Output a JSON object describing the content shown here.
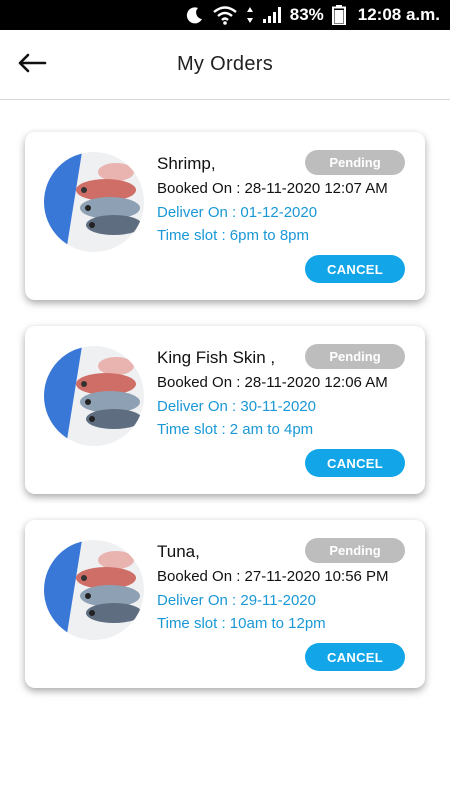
{
  "status_bar": {
    "battery": "83%",
    "time": "12:08 a.m."
  },
  "header": {
    "title": "My Orders"
  },
  "orders": [
    {
      "name": "Shrimp,",
      "status": "Pending",
      "booked_on": "Booked On : 28-11-2020 12:07 AM",
      "deliver_on": "Deliver On  : 01-12-2020",
      "time_slot": "Time slot : 6pm to 8pm",
      "cancel_label": "CANCEL"
    },
    {
      "name": "King Fish Skin ,",
      "status": "Pending",
      "booked_on": "Booked On : 28-11-2020 12:06 AM",
      "deliver_on": "Deliver On  : 30-11-2020",
      "time_slot": "Time slot : 2 am to 4pm",
      "cancel_label": "CANCEL"
    },
    {
      "name": "Tuna,",
      "status": "Pending",
      "booked_on": "Booked On : 27-11-2020 10:56 PM",
      "deliver_on": "Deliver On  : 29-11-2020",
      "time_slot": "Time slot : 10am to 12pm",
      "cancel_label": "CANCEL"
    }
  ],
  "colors": {
    "accent": "#12a6e8",
    "link_text": "#1a98d6",
    "pill": "#bdbdbd"
  },
  "icons": {
    "back": "arrow-left-icon",
    "moon": "moon-icon",
    "wifi": "wifi-icon",
    "signal": "signal-icon",
    "battery": "battery-icon"
  }
}
